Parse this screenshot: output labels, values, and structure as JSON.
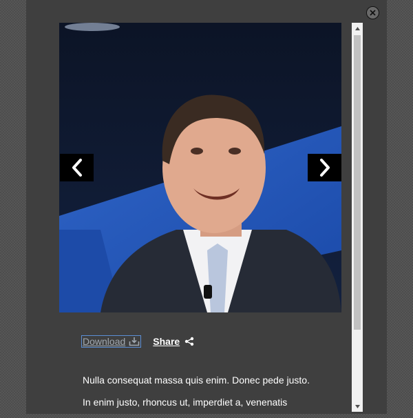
{
  "close": {
    "icon": "close-icon"
  },
  "photo": {
    "alt": "Speaker smiling on stage in a dark suit and light blue tie"
  },
  "gallery": {
    "prev_icon": "chevron-left-icon",
    "next_icon": "chevron-right-icon"
  },
  "actions": {
    "download_label": "Download",
    "download_icon": "download-icon",
    "share_label": "Share",
    "share_icon": "share-icon"
  },
  "article": {
    "paragraphs": [
      "Nulla consequat massa quis enim. Donec pede justo.",
      "In enim justo, rhoncus ut, imperdiet a, venenatis"
    ]
  },
  "colors": {
    "modal_bg": "#3f3f3f",
    "focus_outline": "#5b8fd6"
  }
}
